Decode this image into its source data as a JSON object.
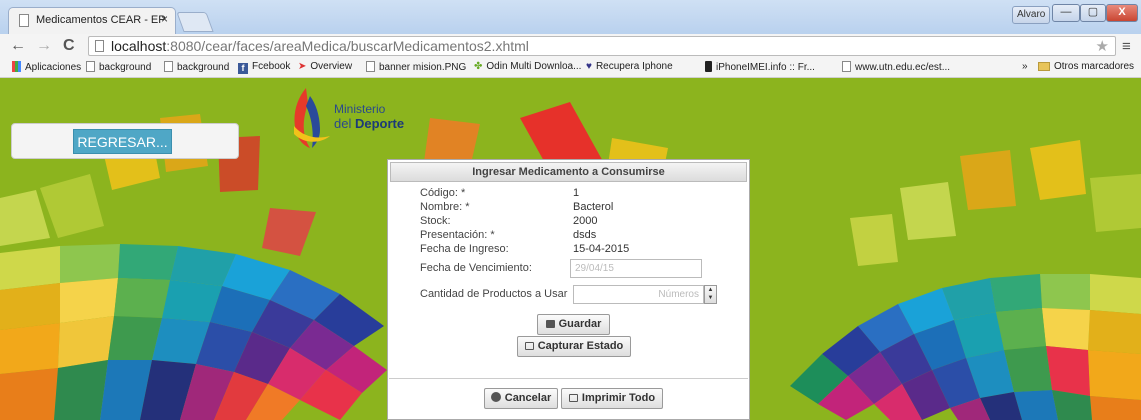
{
  "browser": {
    "tab_title": "Medicamentos CEAR - EP",
    "tab_close": "×",
    "user_name": "Alvaro",
    "window_buttons": {
      "minimize": "—",
      "maximize": "▢",
      "close": "X"
    },
    "url_host": "localhost",
    "url_path": ":8080/cear/faces/areaMedica/buscarMedicamentos2.xhtml",
    "nav": {
      "back": "←",
      "forward": "→",
      "reload": "C",
      "star": "★",
      "menu": "≡"
    },
    "bookmarks": [
      {
        "label": "Aplicaciones",
        "icon": "apps-grid-icon"
      },
      {
        "label": "background",
        "icon": "page-icon"
      },
      {
        "label": "background",
        "icon": "page-icon"
      },
      {
        "label": "Fcebook",
        "icon": "facebook-icon"
      },
      {
        "label": "Overview",
        "icon": "overview-icon"
      },
      {
        "label": "banner mision.PNG",
        "icon": "page-icon"
      },
      {
        "label": "Odin Multi Downloa...",
        "icon": "odin-icon"
      },
      {
        "label": "Recupera Iphone",
        "icon": "recupera-icon"
      },
      {
        "label": "iPhoneIMEI.info :: Fr...",
        "icon": "phone-icon"
      },
      {
        "label": "www.utn.edu.ec/est...",
        "icon": "page-icon"
      }
    ],
    "bookmarks_more": "»",
    "other_bookmarks": "Otros marcadores"
  },
  "logo": {
    "line1": "Ministerio",
    "line2_prefix": "del ",
    "line2_bold": "Deporte"
  },
  "regresar_label": "REGRESAR...",
  "dialog": {
    "title": "Ingresar Medicamento a Consumirse",
    "fields": [
      {
        "label": "Código: *",
        "value": "1"
      },
      {
        "label": "Nombre: *",
        "value": "Bacterol"
      },
      {
        "label": "Stock:",
        "value": "2000"
      },
      {
        "label": "Presentación: *",
        "value": "dsds"
      },
      {
        "label": "Fecha de Ingreso:",
        "value": "15-04-2015"
      }
    ],
    "vencimiento_label": "Fecha de Vencimiento:",
    "vencimiento_placeholder": "29/04/15",
    "cantidad_label": "Cantidad de Productos a Usar",
    "cantidad_placeholder": "Números",
    "guardar": "Guardar",
    "capturar": "Capturar Estado",
    "cancelar": "Cancelar",
    "imprimir": "Imprimir Todo"
  },
  "colors": {
    "background": "#8cb41e",
    "regresar": "#4fa7c6"
  }
}
